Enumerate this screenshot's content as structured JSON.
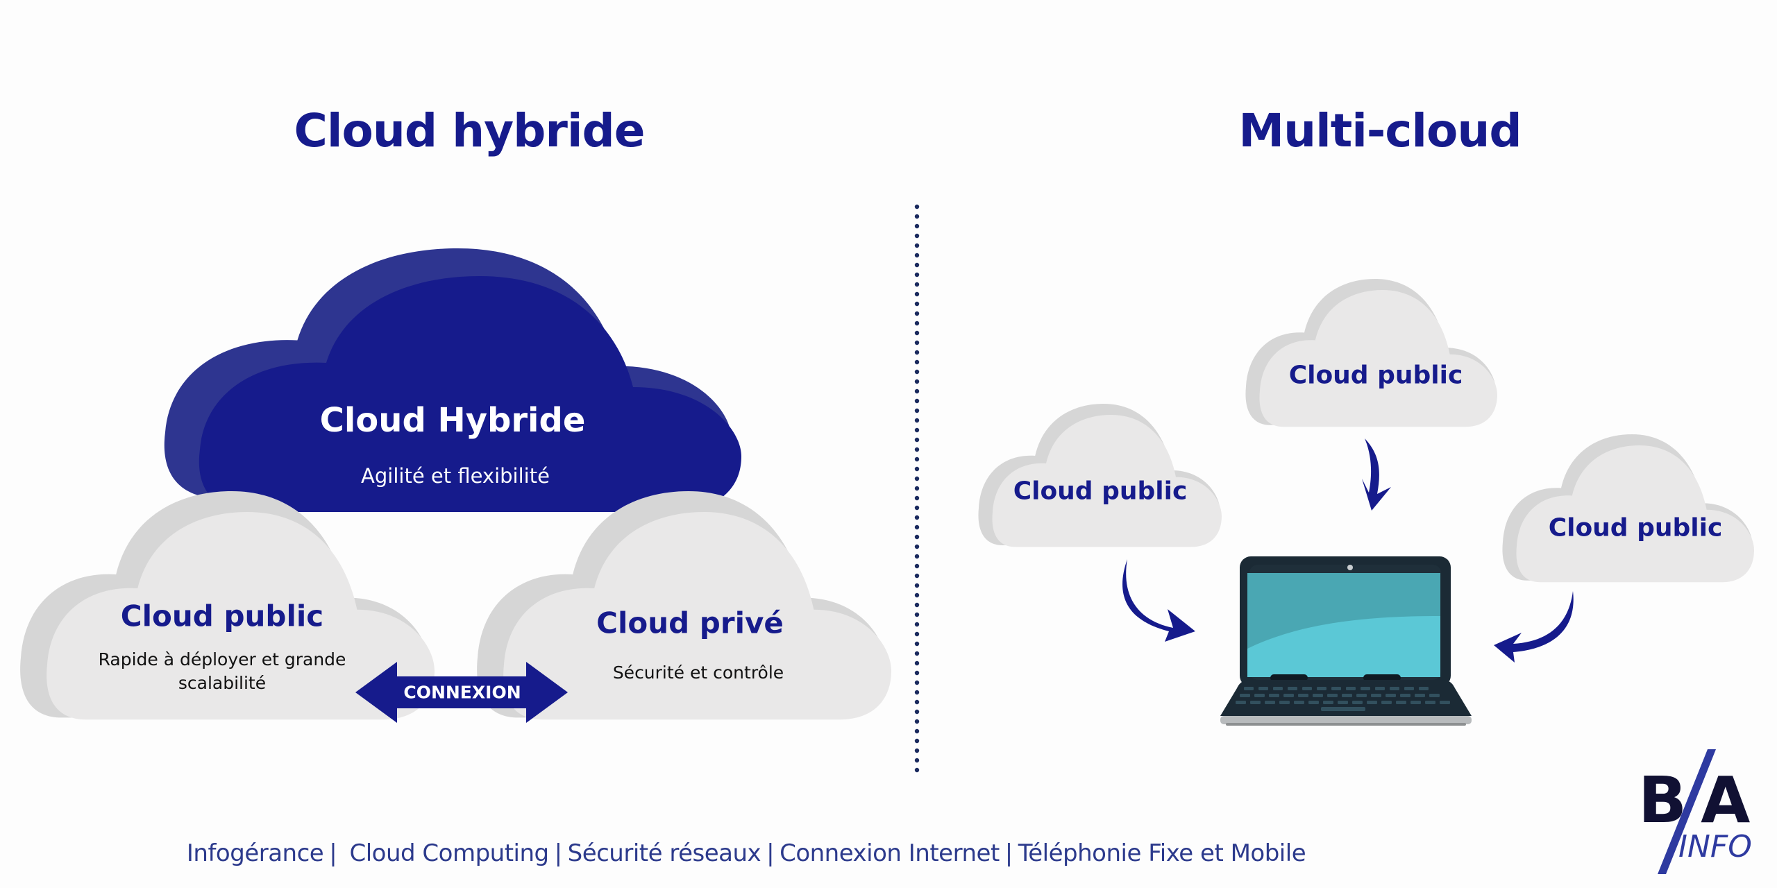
{
  "colors": {
    "brand_navy": "#161b8c",
    "cloud_grey": "#e9e8e8",
    "cloud_shadow": "#d6d6d6",
    "hybrid_shade": "#2e3590",
    "divider": "#1a2a5e",
    "footer_text": "#2c3a8c",
    "laptop_frame": "#1b2a35",
    "screen_dark": "#4aa7b3",
    "screen_light": "#5bc8d6"
  },
  "hybrid": {
    "title": "Cloud hybride",
    "main_cloud": {
      "label": "Cloud Hybride",
      "description": "Agilité et flexibilité"
    },
    "public_cloud": {
      "label": "Cloud public",
      "description_line1": "Rapide à déployer et grande",
      "description_line2": "scalabilité"
    },
    "private_cloud": {
      "label": "Cloud privé",
      "description": "Sécurité et contrôle"
    },
    "connection_arrow": {
      "label": "CONNEXION",
      "icon": "double-arrow-icon"
    }
  },
  "multicloud": {
    "title": "Multi-cloud",
    "clouds": [
      {
        "label": "Cloud public",
        "position": "left"
      },
      {
        "label": "Cloud public",
        "position": "top"
      },
      {
        "label": "Cloud public",
        "position": "right"
      }
    ],
    "device": {
      "icon": "laptop-icon"
    },
    "arrows": [
      "curved-arrow-icon",
      "curved-arrow-icon",
      "curved-arrow-icon"
    ]
  },
  "footer": {
    "items": [
      "Infogérance",
      "Cloud Computing",
      "Sécurité réseaux",
      "Connexion Internet",
      "Téléphonie Fixe et Mobile"
    ],
    "separator": "|"
  },
  "logo": {
    "main": "B/A",
    "sub": "INFO"
  }
}
